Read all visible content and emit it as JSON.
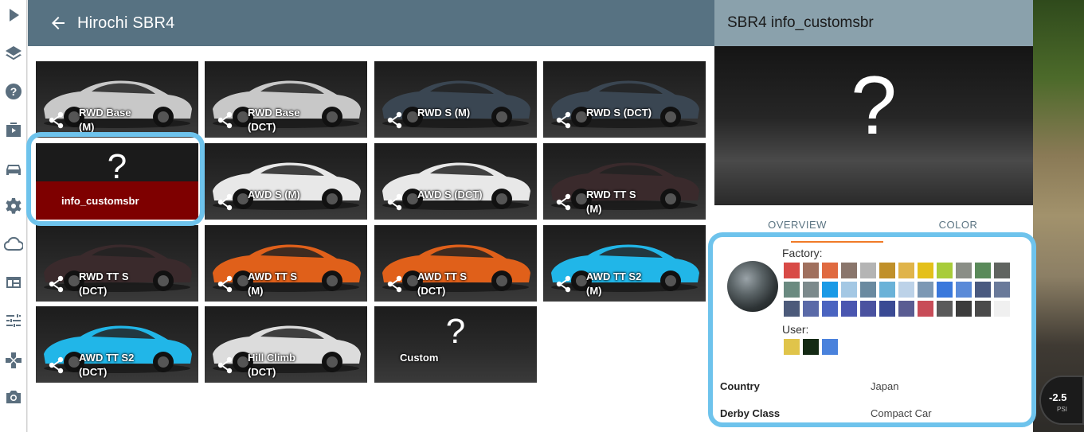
{
  "header": {
    "title": "Hirochi SBR4"
  },
  "sidebar": {
    "icons": [
      "play-icon",
      "layers-icon",
      "help-icon",
      "media-icon",
      "car-icon",
      "settings-icon",
      "cloud-icon",
      "dashboard-icon",
      "sliders-icon",
      "gamepad-icon",
      "camera-icon"
    ]
  },
  "configs": [
    {
      "label": "RWD Base (M)",
      "line1": "RWD Base",
      "line2": "(M)",
      "color": "#c8c8c8"
    },
    {
      "label": "RWD Base (DCT)",
      "line1": "RWD Base",
      "line2": "(DCT)",
      "color": "#c8c8c8"
    },
    {
      "label": "RWD S (M)",
      "line1": "RWD S (M)",
      "line2": "",
      "color": "#3a4652"
    },
    {
      "label": "RWD S (DCT)",
      "line1": "RWD S (DCT)",
      "line2": "",
      "color": "#3a4652"
    },
    {
      "label": "info_customsbr",
      "line1": "info_customsbr",
      "line2": "",
      "color": "",
      "selected": true,
      "unknown": true
    },
    {
      "label": "AWD S (M)",
      "line1": "AWD S (M)",
      "line2": "",
      "color": "#e8e8e8"
    },
    {
      "label": "AWD S (DCT)",
      "line1": "AWD S (DCT)",
      "line2": "",
      "color": "#e8e8e8"
    },
    {
      "label": "RWD TT S (M)",
      "line1": "RWD TT S",
      "line2": "(M)",
      "color": "#3a2a2c"
    },
    {
      "label": "RWD TT S (DCT)",
      "line1": "RWD TT S",
      "line2": "(DCT)",
      "color": "#3a2a2c"
    },
    {
      "label": "AWD TT S (M)",
      "line1": "AWD TT S",
      "line2": "(M)",
      "color": "#e0601a"
    },
    {
      "label": "AWD TT S (DCT)",
      "line1": "AWD TT S",
      "line2": "(DCT)",
      "color": "#e0601a"
    },
    {
      "label": "AWD TT S2 (M)",
      "line1": "AWD TT S2",
      "line2": "(M)",
      "color": "#21b6e8"
    },
    {
      "label": "AWD TT S2 (DCT)",
      "line1": "AWD TT S2",
      "line2": "(DCT)",
      "color": "#21b6e8"
    },
    {
      "label": "Hill Climb (DCT)",
      "line1": "Hill Climb",
      "line2": "(DCT)",
      "color": "#dcdcdc"
    },
    {
      "label": "Custom",
      "line1": "Custom",
      "line2": "",
      "color": "",
      "unknown": true,
      "noicon": true
    }
  ],
  "panel": {
    "title": "SBR4 info_customsbr",
    "tabs": [
      "OVERVIEW",
      "COLOR"
    ],
    "factory_label": "Factory:",
    "user_label": "User:",
    "factory_colors": [
      "#d84a46",
      "#a0705e",
      "#e06a40",
      "#8a766c",
      "#b4b4b4",
      "#c0902a",
      "#e0b44a",
      "#e4c01a",
      "#a8cc3a",
      "#8a8e86",
      "#5a8a5a",
      "#606460",
      "#6a8a80",
      "#7c8a8c",
      "#1a9ae6",
      "#a4c8e4",
      "#6a8aa0",
      "#6ab2d8",
      "#bcd2e8",
      "#7c98b4",
      "#3a78dc",
      "#5a8ad8",
      "#4a5a80",
      "#6a7a9a",
      "#4c5a7a",
      "#5a6aa8",
      "#4a64c0",
      "#4a56b0",
      "#4a52a0",
      "#3a4a94",
      "#5a5c92",
      "#c84c58",
      "#5a5a5a",
      "#3c3c3c",
      "#4a4a4a",
      "#f0f0f0"
    ],
    "user_colors": [
      "#e0c44a",
      "#142a14",
      "#4a82dc"
    ],
    "props": [
      {
        "key": "Country",
        "value": "Japan"
      },
      {
        "key": "Derby Class",
        "value": "Compact Car"
      }
    ]
  },
  "gauge": {
    "value": "-2.5",
    "unit": "PSI"
  }
}
